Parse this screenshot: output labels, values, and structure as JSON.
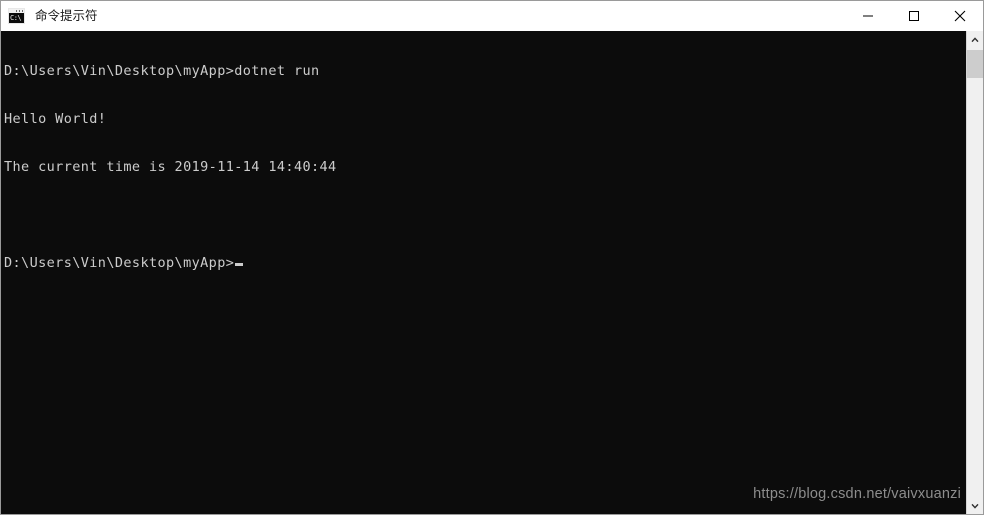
{
  "window": {
    "title": "命令提示符",
    "icon": "cmd-icon",
    "icon_glyph": "C:\\",
    "background_color": "#0c0c0c",
    "titlebar_color": "#ffffff",
    "text_color": "#cccccc"
  },
  "caption_buttons": [
    {
      "name": "minimize-button",
      "label": "—"
    },
    {
      "name": "maximize-button",
      "label": "□"
    },
    {
      "name": "close-button",
      "label": "✕"
    }
  ],
  "console": {
    "lines": [
      "D:\\Users\\Vin\\Desktop\\myApp>dotnet run",
      "Hello World!",
      "The current time is 2019-11-14 14:40:44",
      "",
      "D:\\Users\\Vin\\Desktop\\myApp>"
    ],
    "prompt": "D:\\Users\\Vin\\Desktop\\myApp>",
    "command": "dotnet run",
    "output_greeting": "Hello World!",
    "output_time_line": "The current time is 2019-11-14 14:40:44",
    "date": "2019-11-14",
    "time": "14:40:44",
    "cursor_visible": true
  },
  "watermark": {
    "text": "https://blog.csdn.net/vaivxuanzi"
  },
  "scrollbar": {
    "up_arrow": "chevron-up-icon",
    "down_arrow": "chevron-down-icon",
    "thumb_position": "top"
  }
}
